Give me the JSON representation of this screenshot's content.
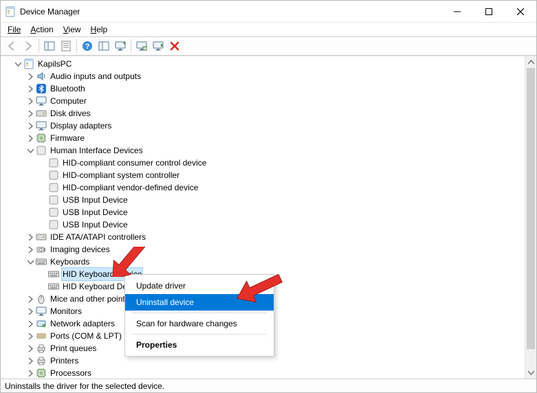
{
  "window": {
    "title": "Device Manager"
  },
  "menu": {
    "file": "File",
    "action": "Action",
    "view": "View",
    "help": "Help"
  },
  "tree": {
    "root": "KapilsPC",
    "n0": "Audio inputs and outputs",
    "n1": "Bluetooth",
    "n2": "Computer",
    "n3": "Disk drives",
    "n4": "Display adapters",
    "n5": "Firmware",
    "n6": "Human Interface Devices",
    "n6c": [
      "HID-compliant consumer control device",
      "HID-compliant system controller",
      "HID-compliant vendor-defined device",
      "USB Input Device",
      "USB Input Device",
      "USB Input Device"
    ],
    "n7": "IDE ATA/ATAPI controllers",
    "n8": "Imaging devices",
    "n9": "Keyboards",
    "n9c": [
      "HID Keyboard Device",
      "HID Keyboard Device"
    ],
    "n10": "Mice and other pointing devices",
    "n11": "Monitors",
    "n12": "Network adapters",
    "n13": "Ports (COM & LPT)",
    "n14": "Print queues",
    "n15": "Printers",
    "n16": "Processors"
  },
  "contextMenu": {
    "update": "Update driver",
    "uninstall": "Uninstall device",
    "scan": "Scan for hardware changes",
    "properties": "Properties"
  },
  "status": {
    "text": "Uninstalls the driver for the selected device."
  }
}
